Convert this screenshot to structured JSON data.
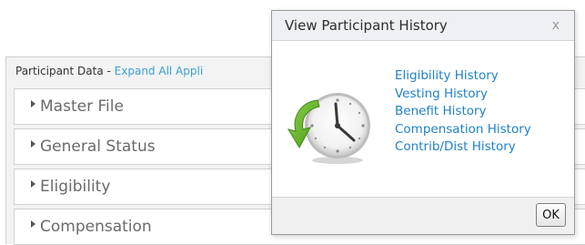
{
  "panel": {
    "prefix": "Participant Data - ",
    "expand_link": "Expand All Appli",
    "sections": [
      {
        "label": "Master File"
      },
      {
        "label": "General Status"
      },
      {
        "label": "Eligibility"
      },
      {
        "label": "Compensation"
      }
    ]
  },
  "dialog": {
    "title": "View Participant History",
    "close_glyph": "x",
    "icon": "clock-history-icon",
    "links": [
      {
        "label": "Eligibility History"
      },
      {
        "label": "Vesting History"
      },
      {
        "label": "Benefit History"
      },
      {
        "label": "Compensation History"
      },
      {
        "label": "Contrib/Dist History"
      }
    ],
    "ok_label": "OK"
  },
  "colors": {
    "link": "#1f82c9",
    "header_link": "#3aa0d8",
    "arrow_green": "#6fb52c"
  }
}
